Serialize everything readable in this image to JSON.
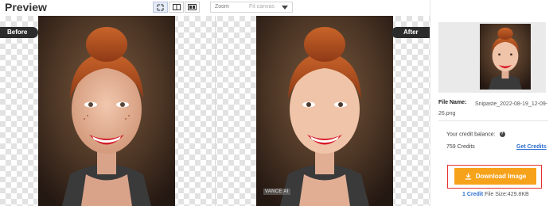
{
  "header": {
    "title": "Preview",
    "zoom_label": "Zoom",
    "zoom_value": "Fit canvas",
    "view_modes": [
      "fit-icon",
      "split-icon",
      "compare-icon"
    ]
  },
  "preview": {
    "before_label": "Before",
    "after_label": "After",
    "watermark": "VANCE AI"
  },
  "panel": {
    "file_name_label": "File Name:",
    "file_name": "Snipaste_2022-08-19_12-09-26.png",
    "credit_balance_label": "Your credit balance:",
    "credits": "759 Credits",
    "get_credits": "Get Credits",
    "download_label": "Download Image",
    "cost_credit": "1 Credit",
    "file_size": "File Size:429.8KB"
  },
  "colors": {
    "accent_orange": "#f7a21b",
    "highlight_red": "#e5322d",
    "link_blue": "#2e6fd1",
    "tag_dark": "#2b2b2b"
  }
}
